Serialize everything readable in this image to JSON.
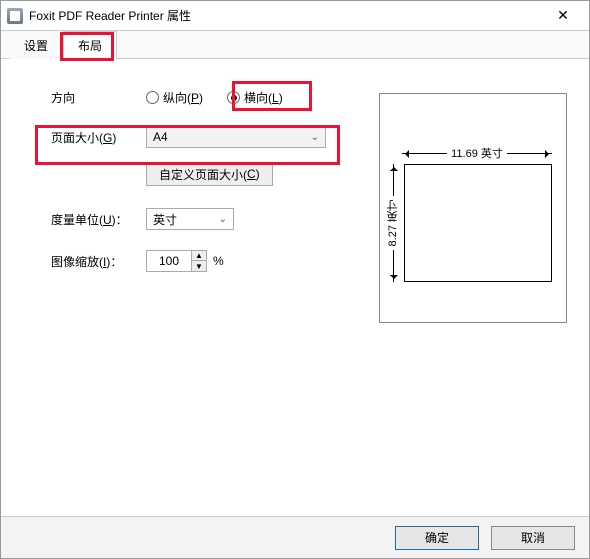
{
  "window": {
    "title": "Foxit PDF Reader Printer 属性",
    "close": "✕"
  },
  "tabs": {
    "settings": "设置",
    "layout": "布局"
  },
  "form": {
    "orientation": {
      "label": "方向",
      "portrait_prefix": "纵向(",
      "portrait_key": "P",
      "portrait_suffix": ")",
      "landscape_prefix": "横向(",
      "landscape_key": "L",
      "landscape_suffix": ")"
    },
    "pageSize": {
      "label_prefix": "页面大小(",
      "label_key": "G",
      "label_suffix": ")",
      "value": "A4"
    },
    "customSize": {
      "label_prefix": "自定义页面大小(",
      "label_key": "C",
      "label_suffix": ")"
    },
    "unit": {
      "label_prefix": "度量单位(",
      "label_key": "U",
      "label_suffix": ")：",
      "value": "英寸"
    },
    "scale": {
      "label_prefix": "图像缩放(",
      "label_key": "I",
      "label_suffix": ")：",
      "value": "100",
      "percent": "%"
    }
  },
  "preview": {
    "width_label": "11.69 英寸",
    "height_label": "8.27 英寸"
  },
  "footer": {
    "ok": "确定",
    "cancel": "取消"
  }
}
